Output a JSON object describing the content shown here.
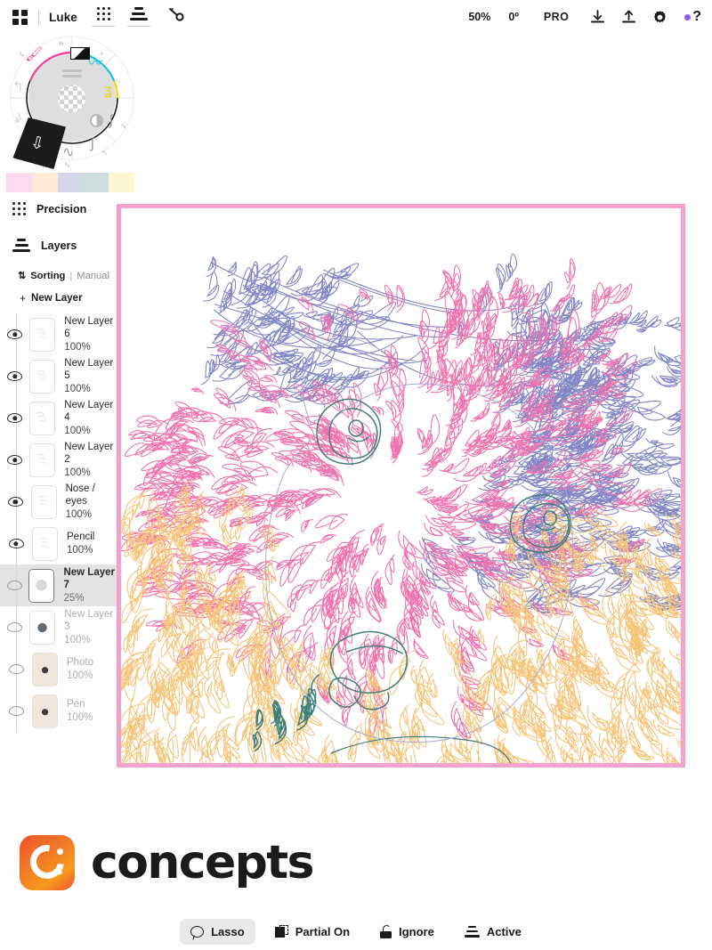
{
  "topbar": {
    "grid_icon": "grid-apps-icon",
    "user_name": "Luke",
    "precision_icon": "precision-dots-icon",
    "layers_icon": "layers-stack-icon",
    "select_icon": "lasso-select-icon",
    "zoom_level": "50%",
    "rotation": "0º",
    "pro_label": "PRO",
    "import_icon": "download-import-icon",
    "export_icon": "upload-export-icon",
    "settings_icon": "gear-settings-icon",
    "help_label": "?"
  },
  "wheel": {
    "name": "brush-color-wheel",
    "center_icon": "transparency-checker",
    "menu_icon": "hamburger-icon",
    "opacity_icon": "opacity-half-circle-icon",
    "brush_icon": "brush-wave-icon",
    "nib_icon": "active-nib-cursor",
    "undo_icon": "undo-arrow-icon",
    "redo_icon": "redo-arrow-icon",
    "segments": [
      {
        "label": "⅓",
        "icon": "gradient-swatch"
      },
      {
        "label": "⁰",
        "icon": "cyan-stroke"
      },
      {
        "label": "¹₀",
        "icon": "yellow-stroke"
      },
      {
        "label": "⁴₆",
        "icon": "gray-wave"
      },
      {
        "label": "⁴₁",
        "icon": "gray-curve"
      },
      {
        "label": "⁶₂",
        "icon": "gray-squiggle"
      },
      {
        "label": "⁵₇",
        "icon": "gray-tilde"
      },
      {
        "label": "¹₄",
        "icon": "pink-brush"
      }
    ]
  },
  "swatches": {
    "name": "color-swatch-palette",
    "colors": [
      "#fbdcef",
      "#fde9d5",
      "#d4d6ea",
      "#cfdfe0",
      "#fdf6d2"
    ]
  },
  "panels": {
    "precision_label": "Precision",
    "layers_label": "Layers",
    "sorting_label": "Sorting",
    "sorting_separator": "|",
    "sorting_value": "Manual",
    "new_layer_label": "New Layer",
    "new_layer_plus": "+"
  },
  "layers": [
    {
      "name": "New Layer 6",
      "opacity": "100%",
      "visible": true,
      "selected": false,
      "thumb": "ink"
    },
    {
      "name": "New Layer 5",
      "opacity": "100%",
      "visible": true,
      "selected": false,
      "thumb": "ink"
    },
    {
      "name": "New Layer 4",
      "opacity": "100%",
      "visible": true,
      "selected": false,
      "thumb": "ink"
    },
    {
      "name": "New Layer 2",
      "opacity": "100%",
      "visible": true,
      "selected": false,
      "thumb": "ink"
    },
    {
      "name": "Nose / eyes",
      "opacity": "100%",
      "visible": true,
      "selected": false,
      "thumb": "ink"
    },
    {
      "name": "Pencil",
      "opacity": "100%",
      "visible": true,
      "selected": false,
      "thumb": "ink"
    },
    {
      "name": "New Layer 7",
      "opacity": "25%",
      "visible": false,
      "selected": true,
      "thumb": "faint"
    },
    {
      "name": "New Layer 3",
      "opacity": "100%",
      "visible": false,
      "selected": false,
      "thumb": "mono"
    },
    {
      "name": "Photo",
      "opacity": "100%",
      "visible": false,
      "selected": false,
      "thumb": "photo"
    },
    {
      "name": "Pen",
      "opacity": "100%",
      "visible": false,
      "selected": false,
      "thumb": "photo"
    }
  ],
  "canvas": {
    "name": "drawing-canvas",
    "subject": "line-art dog portrait",
    "selection_border_color": "#f58fc6",
    "stroke_colors": {
      "pink": "#f072ae",
      "blue": "#8186c4",
      "teal": "#3f7f79",
      "gold": "#f5c57a"
    }
  },
  "logo": {
    "name": "concepts-logo",
    "text": "concepts",
    "mark_color": "#f2522a"
  },
  "bottombar": [
    {
      "label": "Lasso",
      "icon": "lasso-icon",
      "active": true
    },
    {
      "label": "Partial On",
      "icon": "partial-select-icon",
      "active": false
    },
    {
      "label": "Ignore",
      "icon": "unlock-icon",
      "active": false
    },
    {
      "label": "Active",
      "icon": "active-layers-icon",
      "active": false
    }
  ]
}
